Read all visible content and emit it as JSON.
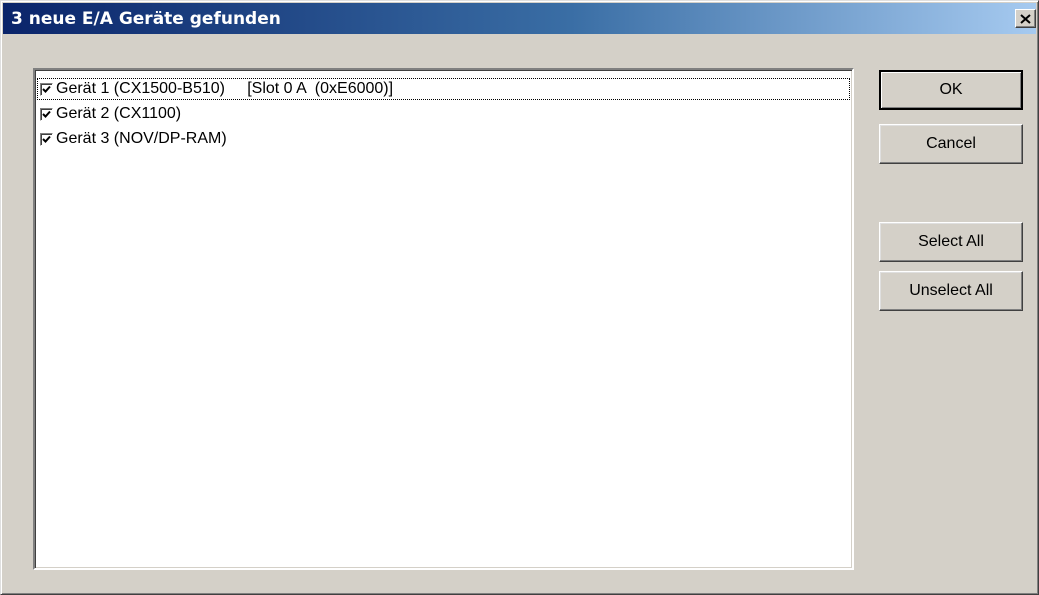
{
  "window": {
    "title": "3 neue E/A Geräte gefunden",
    "close_glyph": "✕"
  },
  "device_list": {
    "items": [
      {
        "label": "Gerät 1 (CX1500-B510)     [Slot 0 A  (0xE6000)]",
        "checked": true,
        "focused": true
      },
      {
        "label": "Gerät 2 (CX1100)",
        "checked": true,
        "focused": false
      },
      {
        "label": "Gerät 3 (NOV/DP-RAM)",
        "checked": true,
        "focused": false
      }
    ]
  },
  "buttons": {
    "ok": "OK",
    "cancel": "Cancel",
    "select_all": "Select All",
    "unselect_all": "Unselect All"
  },
  "colors": {
    "title_gradient_start": "#0a246a",
    "title_gradient_end": "#a6caf0",
    "dialog_face": "#d4d0c8",
    "list_background": "#ffffff"
  }
}
